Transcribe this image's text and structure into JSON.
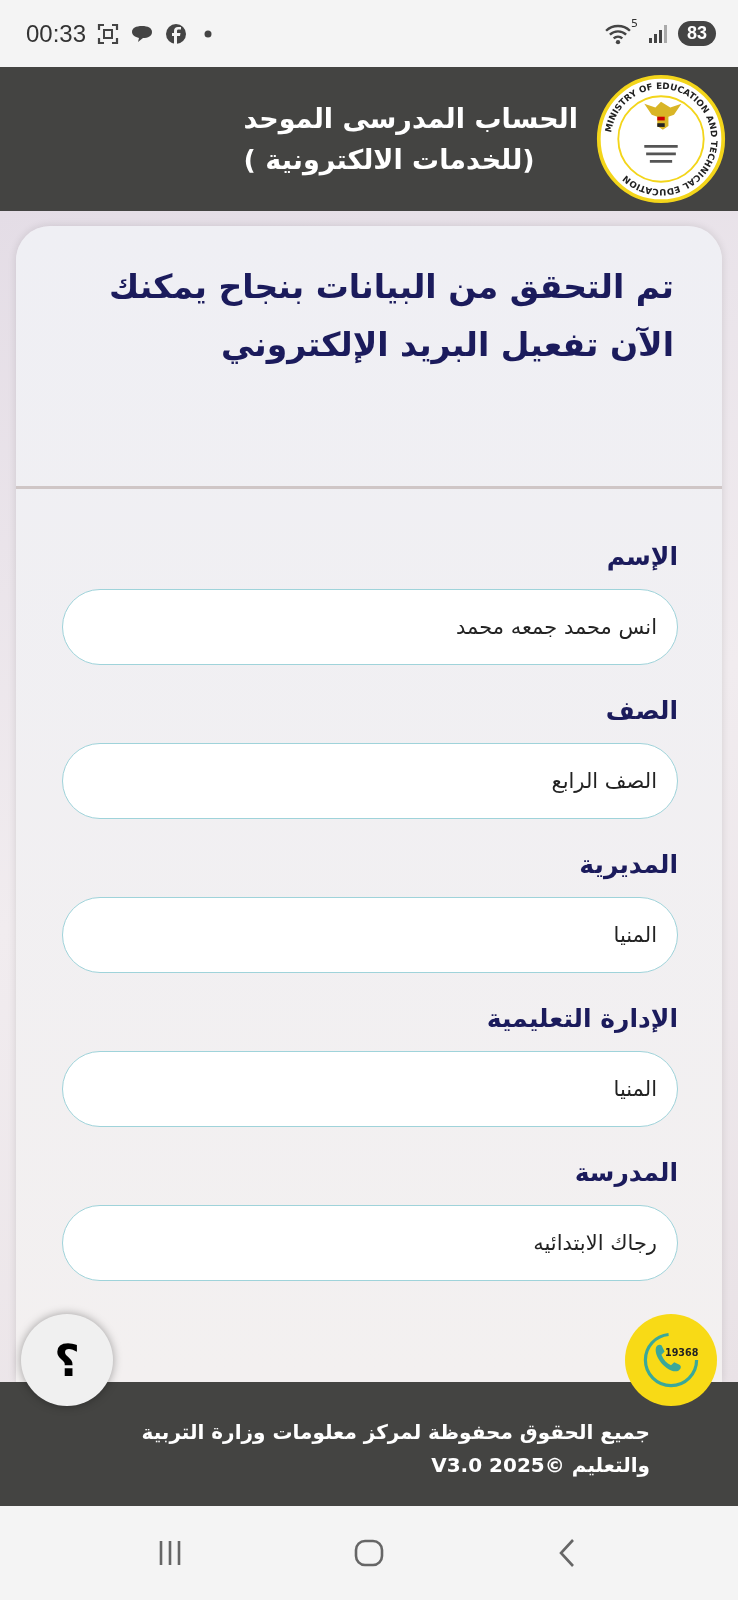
{
  "status_bar": {
    "time": "00:33",
    "wifi_badge": "5",
    "battery": "83"
  },
  "header": {
    "title_line_1": "الحساب المدرسى الموحد",
    "title_line_2": "(للخدمات الالكترونية )",
    "logo_text": "MINISTRY OF EDUCATION AND TECHNICAL EDUCATION"
  },
  "card": {
    "heading": "تم التحقق من البيانات بنجاح يمكنك الآن تفعيل البريد الإلكتروني",
    "fields": [
      {
        "label": "الإسم",
        "value": "انس محمد جمعه محمد"
      },
      {
        "label": "الصف",
        "value": "الصف الرابع"
      },
      {
        "label": "المديرية",
        "value": "المنيا"
      },
      {
        "label": "الإدارة التعليمية",
        "value": "المنيا"
      },
      {
        "label": "المدرسة",
        "value": "رجاك الابتدائيه"
      }
    ]
  },
  "help_button": {
    "symbol": "؟"
  },
  "hotline_button": {
    "number": "19368"
  },
  "footer": {
    "text": "جميع الحقوق محفوظة لمركز معلومات وزارة التربية والتعليم ©2025 V3.0"
  }
}
